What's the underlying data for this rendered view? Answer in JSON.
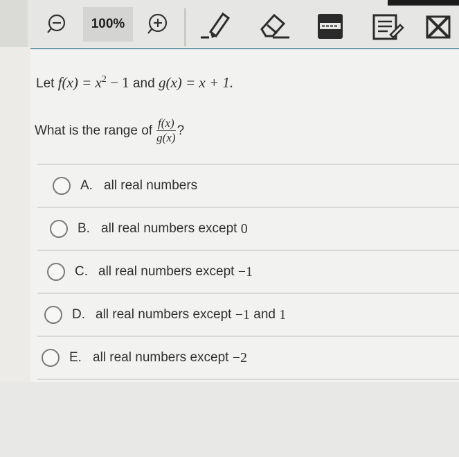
{
  "toolbar": {
    "zoom_level": "100%",
    "tools": [
      "zoom-out-icon",
      "zoom-in-icon",
      "highlighter-icon",
      "eraser-icon",
      "line-reader-icon",
      "notepad-icon",
      "answer-eliminator-icon"
    ]
  },
  "question": {
    "intro_prefix": "Let",
    "f_def": "f(x) = x",
    "f_exp": "2",
    "f_tail": " − 1",
    "intro_mid": "and",
    "g_def": "g(x) = x + 1.",
    "prompt_prefix": "What is the range of",
    "frac_num": "f(x)",
    "frac_den": "g(x)",
    "prompt_suffix": "?"
  },
  "choices": [
    {
      "letter": "A.",
      "text": "all real numbers",
      "math": ""
    },
    {
      "letter": "B.",
      "text": "all real numbers except",
      "math": "0"
    },
    {
      "letter": "C.",
      "text": "all real numbers except",
      "math": "−1"
    },
    {
      "letter": "D.",
      "text": "all real numbers except",
      "math": "−1",
      "text2": "and",
      "math2": "1"
    },
    {
      "letter": "E.",
      "text": "all real numbers except",
      "math": "−2"
    }
  ]
}
